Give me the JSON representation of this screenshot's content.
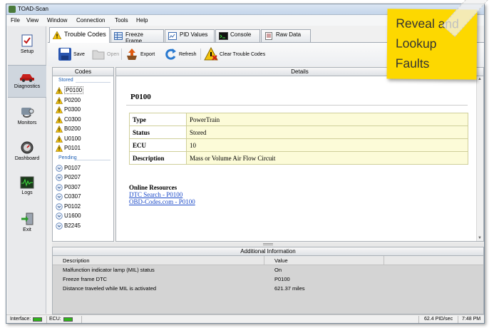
{
  "window": {
    "title": "TOAD-Scan"
  },
  "menu": [
    "File",
    "View",
    "Window",
    "Connection",
    "Tools",
    "Help"
  ],
  "sidebar": [
    {
      "label": "Setup",
      "icon": "setup-checklist-icon"
    },
    {
      "label": "Diagnostics",
      "icon": "car-diagnostics-icon",
      "selected": true
    },
    {
      "label": "Monitors",
      "icon": "stethoscope-icon"
    },
    {
      "label": "Dashboard",
      "icon": "speedometer-icon"
    },
    {
      "label": "Logs",
      "icon": "waveform-log-icon"
    },
    {
      "label": "Exit",
      "icon": "exit-door-icon"
    }
  ],
  "tabs": [
    {
      "label": "Trouble Codes",
      "icon": "warning-icon",
      "selected": true
    },
    {
      "label": "Freeze Frame",
      "icon": "table-grid-icon"
    },
    {
      "label": "PID Values",
      "icon": "pid-values-icon"
    },
    {
      "label": "Console",
      "icon": "console-icon"
    },
    {
      "label": "Raw Data",
      "icon": "raw-data-icon"
    }
  ],
  "toolbar": {
    "save": "Save",
    "open": "Open",
    "export": "Export",
    "refresh": "Refresh",
    "clear": "Clear Trouble Codes"
  },
  "codes": {
    "header": "Codes",
    "stored_label": "Stored",
    "stored": [
      "P0100",
      "P0200",
      "P0300",
      "C0300",
      "B0200",
      "U0100",
      "P0101"
    ],
    "selected": "P0100",
    "pending_label": "Pending",
    "pending": [
      "P0107",
      "P0207",
      "P0307",
      "C0307",
      "P0102",
      "U1600",
      "B2245"
    ]
  },
  "details": {
    "header": "Details",
    "code": "P0100",
    "rows": [
      {
        "key": "Type",
        "value": "PowerTrain"
      },
      {
        "key": "Status",
        "value": "Stored"
      },
      {
        "key": "ECU",
        "value": "10"
      },
      {
        "key": "Description",
        "value": "Mass or Volume Air Flow Circuit"
      }
    ],
    "online_title": "Online Resources",
    "links": [
      "DTC Search - P0100",
      "OBD-Codes.com - P0100"
    ]
  },
  "additional": {
    "header": "Additional Information",
    "col_description": "Description",
    "col_value": "Value",
    "rows": [
      {
        "description": "Malfunction indicator lamp (MIL) status",
        "value": "On"
      },
      {
        "description": "Freeze frame DTC",
        "value": "P0100"
      },
      {
        "description": "Distance traveled while MIL is activated",
        "value": "621.37 miles"
      }
    ]
  },
  "statusbar": {
    "interface": "Interface:",
    "ecu": "ECU:",
    "rate": "62.4 PID/sec",
    "time": "7:48 PM"
  },
  "note": {
    "lines": [
      "Reveal and",
      "Lookup",
      "Faults"
    ]
  },
  "colors": {
    "led_on": "#2fb51b",
    "note_bg": "#fdd800",
    "link": "#1a49c8",
    "detail_value_bg": "#fcfbd8"
  }
}
